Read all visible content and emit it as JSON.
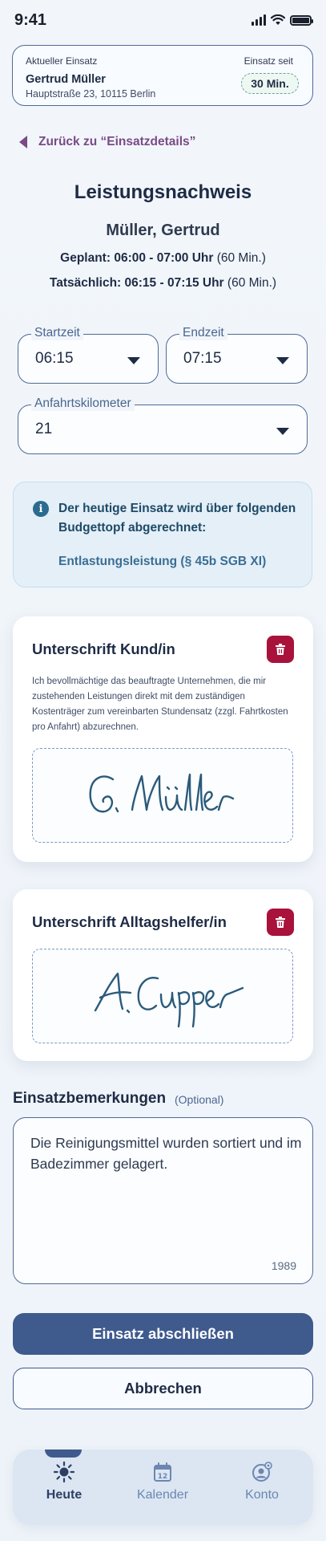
{
  "status_bar": {
    "time": "9:41"
  },
  "assignment": {
    "label": "Aktueller Einsatz",
    "name": "Gertrud Müller",
    "address": "Hauptstraße 23, 10115 Berlin",
    "since_label": "Einsatz seit",
    "since_value": "30 Min."
  },
  "back_link": {
    "label": "Zurück zu “Einsatzdetails”"
  },
  "header": {
    "title": "Leistungsnachweis",
    "client": "Müller, Gertrud",
    "planned_label": "Geplant:",
    "planned_time": "06:00 - 07:00 Uhr",
    "planned_duration": "(60 Min.)",
    "actual_label": "Tatsächlich:",
    "actual_time": "06:15 - 07:15 Uhr",
    "actual_duration": "(60 Min.)"
  },
  "fields": {
    "start": {
      "label": "Startzeit",
      "value": "06:15"
    },
    "end": {
      "label": "Endzeit",
      "value": "07:15"
    },
    "km": {
      "label": "Anfahrtskilometer",
      "value": "21"
    }
  },
  "info": {
    "icon": "info-icon",
    "text": "Der heutige Einsatz wird über folgenden Budgettopf abgerechnet:",
    "budget": "Entlastungsleistung (§ 45b SGB XI)"
  },
  "signature_client": {
    "title": "Unterschrift Kund/in",
    "description": "Ich bevollmächtige das beauftragte Unternehmen, die mir zustehenden Leistungen direkt mit dem zuständigen Kostenträger zum vereinbarten Stundensatz (zzgl. Fahrtkosten pro Anfahrt) abzurechnen.",
    "signature": "G. Müller"
  },
  "signature_helper": {
    "title": "Unterschrift Alltagshelfer/in",
    "signature": "A. Cupper"
  },
  "remarks": {
    "label": "Einsatzbemerkungen",
    "optional": "(Optional)",
    "value": "Die Reinigungsmittel wurden sortiert und im Badezimmer gelagert.",
    "counter": "1989"
  },
  "actions": {
    "primary": "Einsatz abschließen",
    "secondary": "Abbrechen"
  },
  "nav": [
    {
      "label": "Heute",
      "icon": "sun-icon",
      "active": true
    },
    {
      "label": "Kalender",
      "icon": "calendar-icon",
      "calendar_day": "12",
      "active": false
    },
    {
      "label": "Konto",
      "icon": "account-icon",
      "active": false
    }
  ],
  "colors": {
    "accent": "#3f5a8d",
    "back_link": "#7a4a86",
    "delete": "#a8123b",
    "info_bg": "#e4eff8",
    "signature_ink": "#2b5a7a"
  }
}
